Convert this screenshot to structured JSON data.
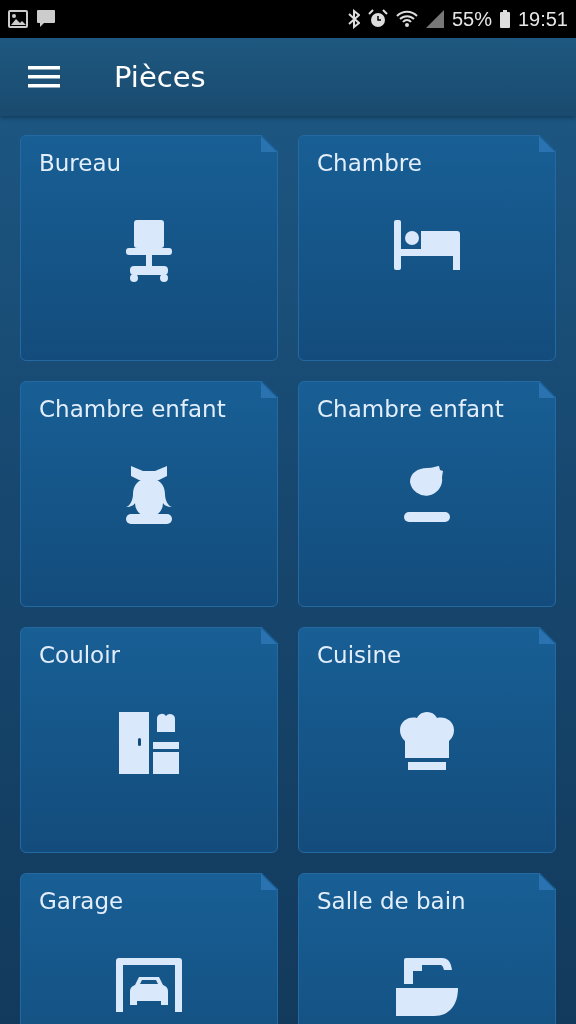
{
  "status_bar": {
    "battery": "55%",
    "time": "19:51"
  },
  "app_bar": {
    "title": "Pièces"
  },
  "rooms": [
    {
      "name": "Bureau"
    },
    {
      "name": "Chambre"
    },
    {
      "name": "Chambre enfant"
    },
    {
      "name": "Chambre enfant"
    },
    {
      "name": "Couloir"
    },
    {
      "name": "Cuisine"
    },
    {
      "name": "Garage"
    },
    {
      "name": "Salle de bain"
    }
  ]
}
